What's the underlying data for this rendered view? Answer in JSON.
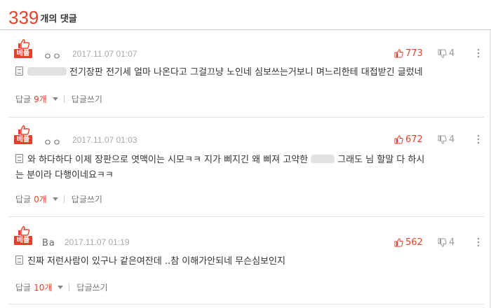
{
  "header": {
    "count": "339",
    "suffix": "개의 댓글"
  },
  "colors": {
    "accent": "#e2422b",
    "muted": "#a8a8a8"
  },
  "icons": {
    "best": "thumb-up-icon",
    "like": "thumb-up-icon",
    "dislike": "thumb-down-icon",
    "more": "more-vertical-icon",
    "text": "document-icon"
  },
  "comments": [
    {
      "badge": "베플",
      "author": "ㅇㅇ",
      "date": "2017.11.07 01:07",
      "likes": "773",
      "dislikes": "4",
      "text_lines": [
        "전기장판 전기세 얼마 나온다고 그걸끄냥 노인네 심보쓰는거보니 며느리한테 대접받긴 글렀네"
      ],
      "reply_label": "답글",
      "reply_count": "9개",
      "write_reply": "답글쓰기"
    },
    {
      "badge": "베플",
      "author": "ㅇㅇ",
      "date": "2017.11.07 01:03",
      "likes": "672",
      "dislikes": "4",
      "text_lines": [
        "와 하다하다 이제 장판으로 엿맥이는 시모ㅋㅋ 지가 삐지긴 왜 삐져 고약한",
        "그래도 님 할말 다 하시",
        "는 분이라 다행이네요ㅋㅋ"
      ],
      "reply_label": "답글",
      "reply_count": "0개",
      "write_reply": "답글쓰기"
    },
    {
      "badge": "베플",
      "author": "Ba",
      "date": "2017.11.07 01:19",
      "likes": "562",
      "dislikes": "4",
      "text_lines": [
        "진짜 저런사람이 있구나 같은여잔데 ..참 이해가안되네 무슨심보인지"
      ],
      "reply_label": "답글",
      "reply_count": "10개",
      "write_reply": "답글쓰기"
    }
  ]
}
